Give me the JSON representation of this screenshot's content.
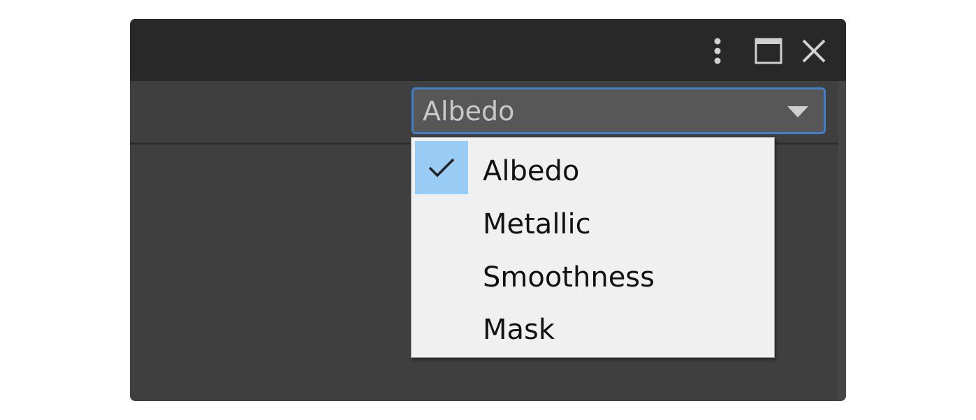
{
  "window": {
    "title_buttons": [
      {
        "name": "more-options",
        "icon": "vertical-ellipsis-icon"
      },
      {
        "name": "maximize",
        "icon": "maximize-icon"
      },
      {
        "name": "close",
        "icon": "close-icon"
      }
    ]
  },
  "dropdown": {
    "selected": "Albedo",
    "icon": "triangle-down-icon"
  },
  "menu": {
    "items": [
      {
        "label": "Albedo",
        "checked": true
      },
      {
        "label": "Metallic",
        "checked": false
      },
      {
        "label": "Smoothness",
        "checked": false
      },
      {
        "label": "Mask",
        "checked": false
      }
    ],
    "check_icon": "checkmark-icon"
  },
  "colors": {
    "titlebar": "#282828",
    "panel": "#3f3f3f",
    "dropdown_bg": "#575757",
    "focus_border": "#3e7fc8",
    "menu_bg": "#f0f0f0",
    "check_highlight": "#99ccf4"
  }
}
